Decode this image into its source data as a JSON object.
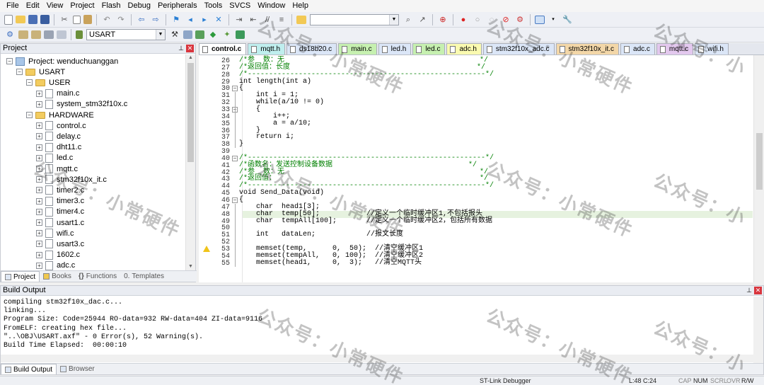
{
  "menu": [
    "File",
    "Edit",
    "View",
    "Project",
    "Flash",
    "Debug",
    "Peripherals",
    "Tools",
    "SVCS",
    "Window",
    "Help"
  ],
  "toolbar2": {
    "target": "USART"
  },
  "project_panel": {
    "title": "Project",
    "tree": [
      {
        "label": "Project: wenduchuanggan",
        "level": 0,
        "kind": "project",
        "expander": "−"
      },
      {
        "label": "USART",
        "level": 1,
        "kind": "folder",
        "expander": "−"
      },
      {
        "label": "USER",
        "level": 2,
        "kind": "folder",
        "expander": "−"
      },
      {
        "label": "main.c",
        "level": 3,
        "kind": "file",
        "expander": "+"
      },
      {
        "label": "system_stm32f10x.c",
        "level": 3,
        "kind": "file",
        "expander": "+"
      },
      {
        "label": "HARDWARE",
        "level": 2,
        "kind": "folder",
        "expander": "−"
      },
      {
        "label": "control.c",
        "level": 3,
        "kind": "file",
        "expander": "+"
      },
      {
        "label": "delay.c",
        "level": 3,
        "kind": "file",
        "expander": "+"
      },
      {
        "label": "dht11.c",
        "level": 3,
        "kind": "file",
        "expander": "+"
      },
      {
        "label": "led.c",
        "level": 3,
        "kind": "file",
        "expander": "+"
      },
      {
        "label": "mqtt.c",
        "level": 3,
        "kind": "file",
        "expander": "+"
      },
      {
        "label": "stm32f10x_it.c",
        "level": 3,
        "kind": "file",
        "expander": "+"
      },
      {
        "label": "timer2.c",
        "level": 3,
        "kind": "file",
        "expander": "+"
      },
      {
        "label": "timer3.c",
        "level": 3,
        "kind": "file",
        "expander": "+"
      },
      {
        "label": "timer4.c",
        "level": 3,
        "kind": "file",
        "expander": "+"
      },
      {
        "label": "usart1.c",
        "level": 3,
        "kind": "file",
        "expander": "+"
      },
      {
        "label": "wifi.c",
        "level": 3,
        "kind": "file",
        "expander": "+"
      },
      {
        "label": "usart3.c",
        "level": 3,
        "kind": "file",
        "expander": "+"
      },
      {
        "label": "1602.c",
        "level": 3,
        "kind": "file",
        "expander": "+"
      },
      {
        "label": "adc.c",
        "level": 3,
        "kind": "file",
        "expander": "+"
      }
    ],
    "tabs": [
      "Project",
      "Books",
      "Functions",
      "Templates"
    ]
  },
  "editor_tabs": [
    {
      "label": "control.c",
      "color": "#dbe6f7",
      "active": true
    },
    {
      "label": "mqtt.h",
      "color": "#bfeeee"
    },
    {
      "label": "ds18b20.c",
      "color": "#dbe6f7"
    },
    {
      "label": "main.c",
      "color": "#c6f0b0"
    },
    {
      "label": "led.h",
      "color": "#dbe6f7"
    },
    {
      "label": "led.c",
      "color": "#c6f0b0"
    },
    {
      "label": "adc.h",
      "color": "#fafab0"
    },
    {
      "label": "stm32f10x_adc.c",
      "color": "#dbe6f7"
    },
    {
      "label": "stm32f10x_it.c",
      "color": "#f3d7a8"
    },
    {
      "label": "adc.c",
      "color": "#dbe6f7"
    },
    {
      "label": "mqtt.c",
      "color": "#e3c8ee"
    },
    {
      "label": "wifi.h",
      "color": "#dbe6f7"
    }
  ],
  "code_lines": [
    {
      "n": "26",
      "t": "/*参  数：无                                              */",
      "c": "cm"
    },
    {
      "n": "27",
      "t": "/*返回值：长度                                            */",
      "c": "cm"
    },
    {
      "n": "28",
      "t": "/*--------------------------------------------------------*/",
      "c": "cm"
    },
    {
      "n": "29",
      "t": "int length(int a)",
      "c": ""
    },
    {
      "n": "30",
      "t": "{",
      "c": "",
      "fold": "−"
    },
    {
      "n": "31",
      "t": "    int i = 1;",
      "c": ""
    },
    {
      "n": "32",
      "t": "    while(a/10 != 0)",
      "c": ""
    },
    {
      "n": "33",
      "t": "    {",
      "c": "",
      "fold": "−"
    },
    {
      "n": "34",
      "t": "        i++;",
      "c": ""
    },
    {
      "n": "35",
      "t": "        a = a/10;",
      "c": ""
    },
    {
      "n": "36",
      "t": "    }",
      "c": ""
    },
    {
      "n": "37",
      "t": "    return i;",
      "c": ""
    },
    {
      "n": "38",
      "t": "}",
      "c": ""
    },
    {
      "n": "39",
      "t": "",
      "c": ""
    },
    {
      "n": "40",
      "t": "/*--------------------------------------------------------*/",
      "c": "cm",
      "fold": "−"
    },
    {
      "n": "41",
      "t": "/*函数名：发送控制设备数据                                */",
      "c": "cm"
    },
    {
      "n": "42",
      "t": "/*参  数：无                                              */",
      "c": "cm"
    },
    {
      "n": "43",
      "t": "/*返回值：                                                */",
      "c": "cm"
    },
    {
      "n": "44",
      "t": "/*--------------------------------------------------------*/",
      "c": "cm"
    },
    {
      "n": "45",
      "t": "void Send_Data(void)",
      "c": ""
    },
    {
      "n": "46",
      "t": "{",
      "c": "",
      "fold": "−"
    },
    {
      "n": "47",
      "t": "    char  head1[3];",
      "c": ""
    },
    {
      "n": "48",
      "t": "    char  temp[50];           //定义一个临时缓冲区1,不包括报头",
      "c": "",
      "hl": true
    },
    {
      "n": "49",
      "t": "    char  tempAll[100];       //定义一个临时缓冲区2，包括所有数据",
      "c": ""
    },
    {
      "n": "50",
      "t": "",
      "c": ""
    },
    {
      "n": "51",
      "t": "    int   dataLen;            //报文长度",
      "c": ""
    },
    {
      "n": "52",
      "t": "",
      "c": ""
    },
    {
      "n": "53",
      "t": "    memset(temp,      0,  50);  //清空缓冲区1",
      "c": "",
      "warn": true
    },
    {
      "n": "54",
      "t": "    memset(tempAll,   0, 100);  //清空缓冲区2",
      "c": ""
    },
    {
      "n": "55",
      "t": "    memset(head1,     0,  3);   //清空MQTT头",
      "c": ""
    }
  ],
  "build_output": {
    "title": "Build Output",
    "lines": [
      "compiling stm32f10x_dac.c...",
      "linking...",
      "Program Size: Code=25944 RO-data=932 RW-data=404 ZI-data=9116",
      "FromELF: creating hex file...",
      "\"..\\OBJ\\USART.axf\" - 0 Error(s), 52 Warning(s).",
      "Build Time Elapsed:  00:00:10"
    ],
    "tabs": [
      "Build Output",
      "Browser"
    ]
  },
  "status": {
    "debugger": "ST-Link Debugger",
    "position": "L:48 C:24",
    "caps": "CAP",
    "num": "NUM",
    "scrl": "SCRL",
    "ovr": "OVR",
    "rw": "R/W"
  },
  "watermark": "公众号：小常硬件"
}
